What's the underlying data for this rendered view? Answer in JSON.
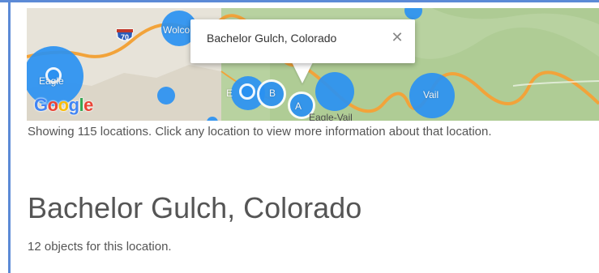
{
  "map": {
    "highway_number": "70",
    "labels": {
      "wolcott": "Wolco",
      "eagle": "Eagle",
      "edwards": "E",
      "bachelor": "B",
      "avon": "A",
      "eagle_vail": "Eagle-Vail",
      "vail": "Vail"
    },
    "logo_letters": [
      "G",
      "o",
      "o",
      "g",
      "l",
      "e"
    ],
    "logo_colors": [
      "#4285f4",
      "#ea4335",
      "#fbbc05",
      "#4285f4",
      "#34a853",
      "#ea4335"
    ],
    "marker_color": "#2a91f2",
    "road_color": "#f2a33a",
    "terrain_color": "#b8d2a0"
  },
  "infowindow": {
    "title": "Bachelor Gulch, Colorado",
    "close_glyph": "✕"
  },
  "summary_text": "Showing 115 locations. Click any location to view more information about that location.",
  "location": {
    "title": "Bachelor Gulch, Colorado",
    "object_count_text": "12 objects for this location."
  }
}
